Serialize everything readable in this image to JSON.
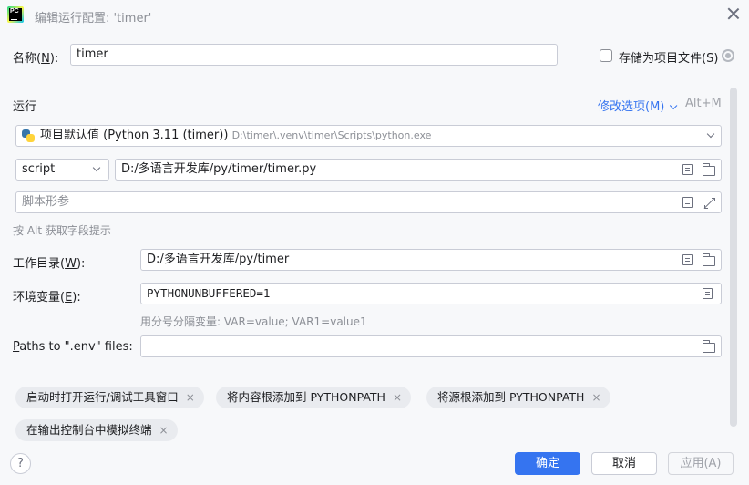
{
  "window": {
    "logo_text": "PC",
    "title": "编辑运行配置: 'timer'"
  },
  "name_row": {
    "label_pre": "名称(",
    "label_mnemonic": "N",
    "label_post": "):",
    "value": "timer",
    "store_label": "存储为项目文件(S)"
  },
  "run": {
    "section_title": "运行",
    "modify_options": "修改选项(M)",
    "modify_shortcut": "Alt+M",
    "interpreter": "项目默认值 (Python 3.11 (timer))",
    "interpreter_path": "D:\\timer\\.venv\\timer\\Scripts\\python.exe",
    "script_type": "script",
    "script_path": "D:/多语言开发库/py/timer/timer.py",
    "script_params_placeholder": "脚本形参",
    "alt_hint": "按 Alt 获取字段提示"
  },
  "workdir": {
    "label_pre": "工作目录(",
    "label_mnemonic": "W",
    "label_post": "):",
    "value": "D:/多语言开发库/py/timer"
  },
  "env": {
    "label_pre": "环境变量(",
    "label_mnemonic": "E",
    "label_post": "):",
    "value": "PYTHONUNBUFFERED=1",
    "hint": "用分号分隔变量: VAR=value; VAR1=value1"
  },
  "dotenv": {
    "label_mnemonic": "P",
    "label_post": "aths to \".env\" files:",
    "value": ""
  },
  "chips": [
    {
      "label": "启动时打开运行/调试工具窗口"
    },
    {
      "label": "将内容根添加到 PYTHONPATH"
    },
    {
      "label": "将源根添加到 PYTHONPATH"
    },
    {
      "label": "在输出控制台中模拟终端"
    }
  ],
  "chip_close_glyph": "×",
  "footer": {
    "help": "?",
    "ok": "确定",
    "cancel": "取消",
    "apply": "应用(A)"
  },
  "colors": {
    "accent": "#3574f0",
    "background": "#f7f8fa"
  }
}
